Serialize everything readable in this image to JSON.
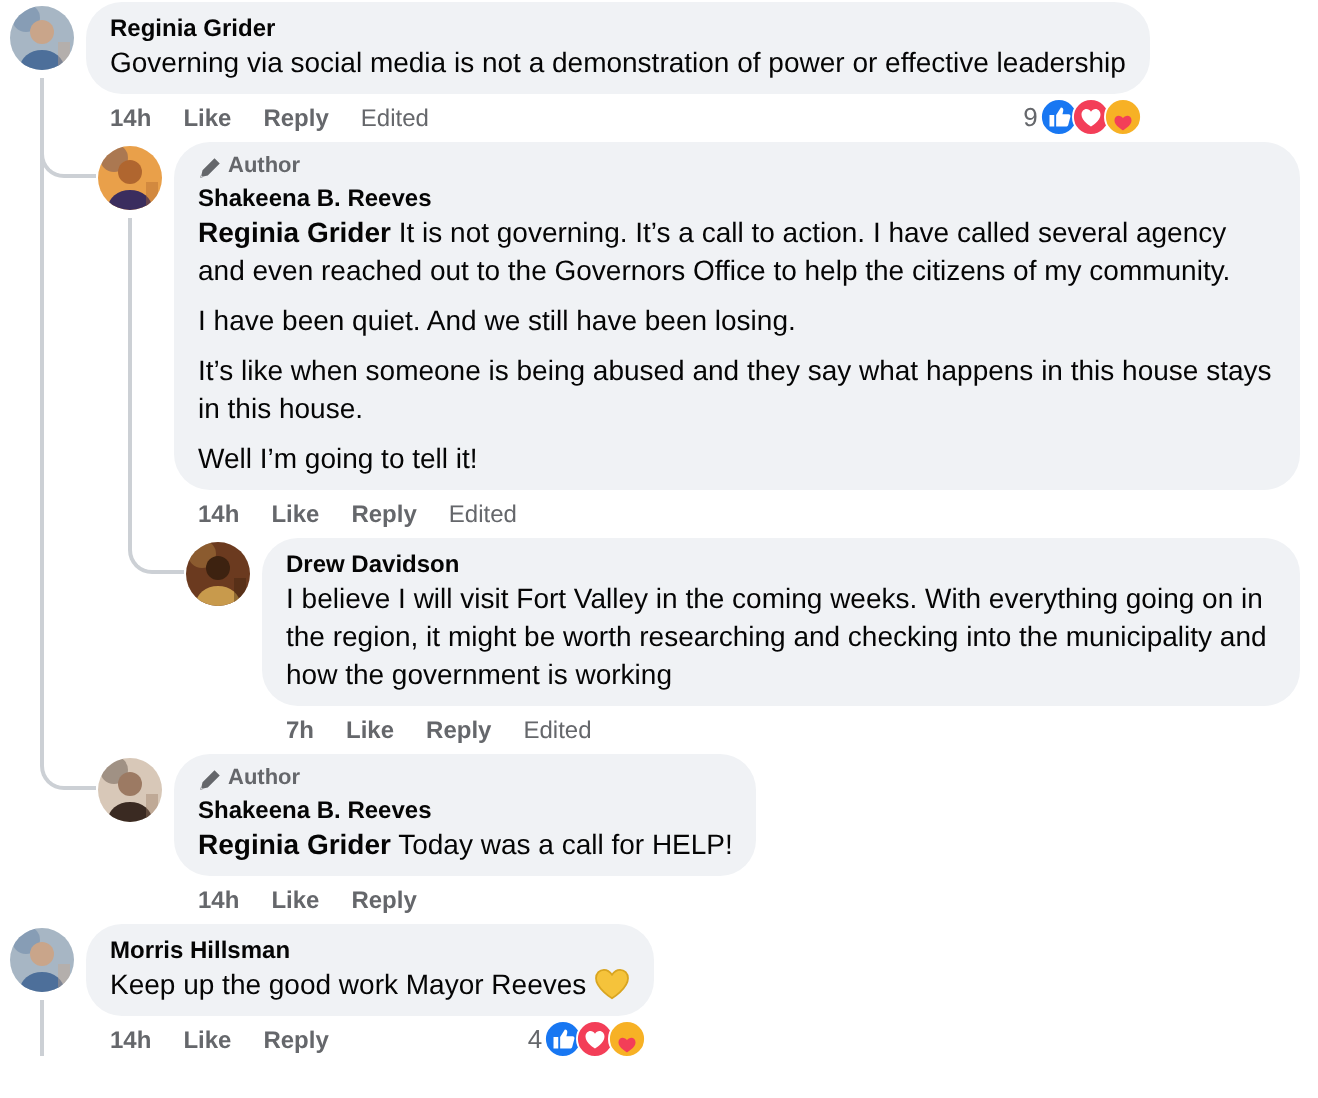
{
  "comments": [
    {
      "author": "Reginia Grider",
      "paragraphs": [
        "Governing via social media is not a demonstration of power or effective leadership"
      ],
      "time": "14h",
      "like": "Like",
      "reply": "Reply",
      "edited": "Edited",
      "reactions": {
        "count": "9",
        "icons": [
          {
            "kind": "like"
          },
          {
            "kind": "love"
          },
          {
            "kind": "care"
          }
        ]
      },
      "thread_continues": false,
      "replies": [
        {
          "badge": "Author",
          "author": "Shakeena B. Reeves",
          "paragraphs": [
            "**Reginia Grider** It is not governing. It’s a call to action. I have called several agency and even reached out to the Governors Office to help the citizens of my community.",
            "I have been quiet. And we still have been losing.",
            "It’s like when someone is being abused and they say what happens in this house stays in this house.",
            "Well I’m going to tell it!"
          ],
          "time": "14h",
          "like": "Like",
          "reply": "Reply",
          "edited": "Edited",
          "replies": [
            {
              "author": "Drew Davidson",
              "paragraphs": [
                "I believe I will visit Fort Valley in the coming weeks. With everything going on in the region, it might be worth researching and checking into the municipality and how the government is working"
              ],
              "time": "7h",
              "like": "Like",
              "reply": "Reply",
              "edited": "Edited"
            }
          ]
        },
        {
          "badge": "Author",
          "author": "Shakeena B. Reeves",
          "paragraphs": [
            "**Reginia Grider** Today was a call for HELP!"
          ],
          "time": "14h",
          "like": "Like",
          "reply": "Reply"
        }
      ]
    },
    {
      "author": "Morris Hillsman",
      "paragraphs": [
        "Keep up the good work Mayor Reeves"
      ],
      "emoji": {
        "kind": "heart"
      },
      "time": "14h",
      "like": "Like",
      "reply": "Reply",
      "reactions": {
        "count": "4",
        "icons": [
          {
            "kind": "like"
          },
          {
            "kind": "love"
          },
          {
            "kind": "care"
          }
        ]
      },
      "thread_continues": true
    }
  ]
}
